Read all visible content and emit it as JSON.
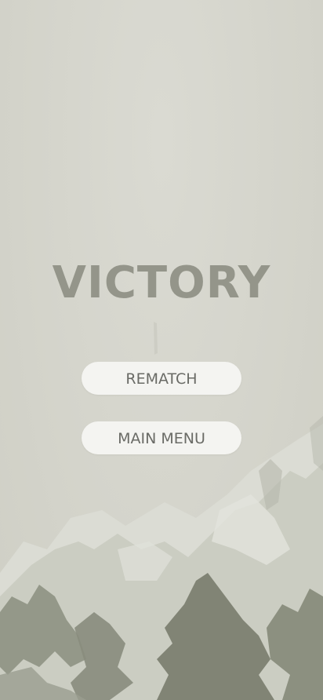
{
  "result": {
    "title": "VICTORY"
  },
  "menu": {
    "rematch_label": "REMATCH",
    "main_menu_label": "MAIN MENU"
  },
  "colors": {
    "background": "#d6d6cd",
    "title": "#94958a",
    "button_bg": "#f4f4f1",
    "button_text": "#6a6b66",
    "ink_dark": "#7c8071",
    "ink_light": "#c2c4b8"
  }
}
